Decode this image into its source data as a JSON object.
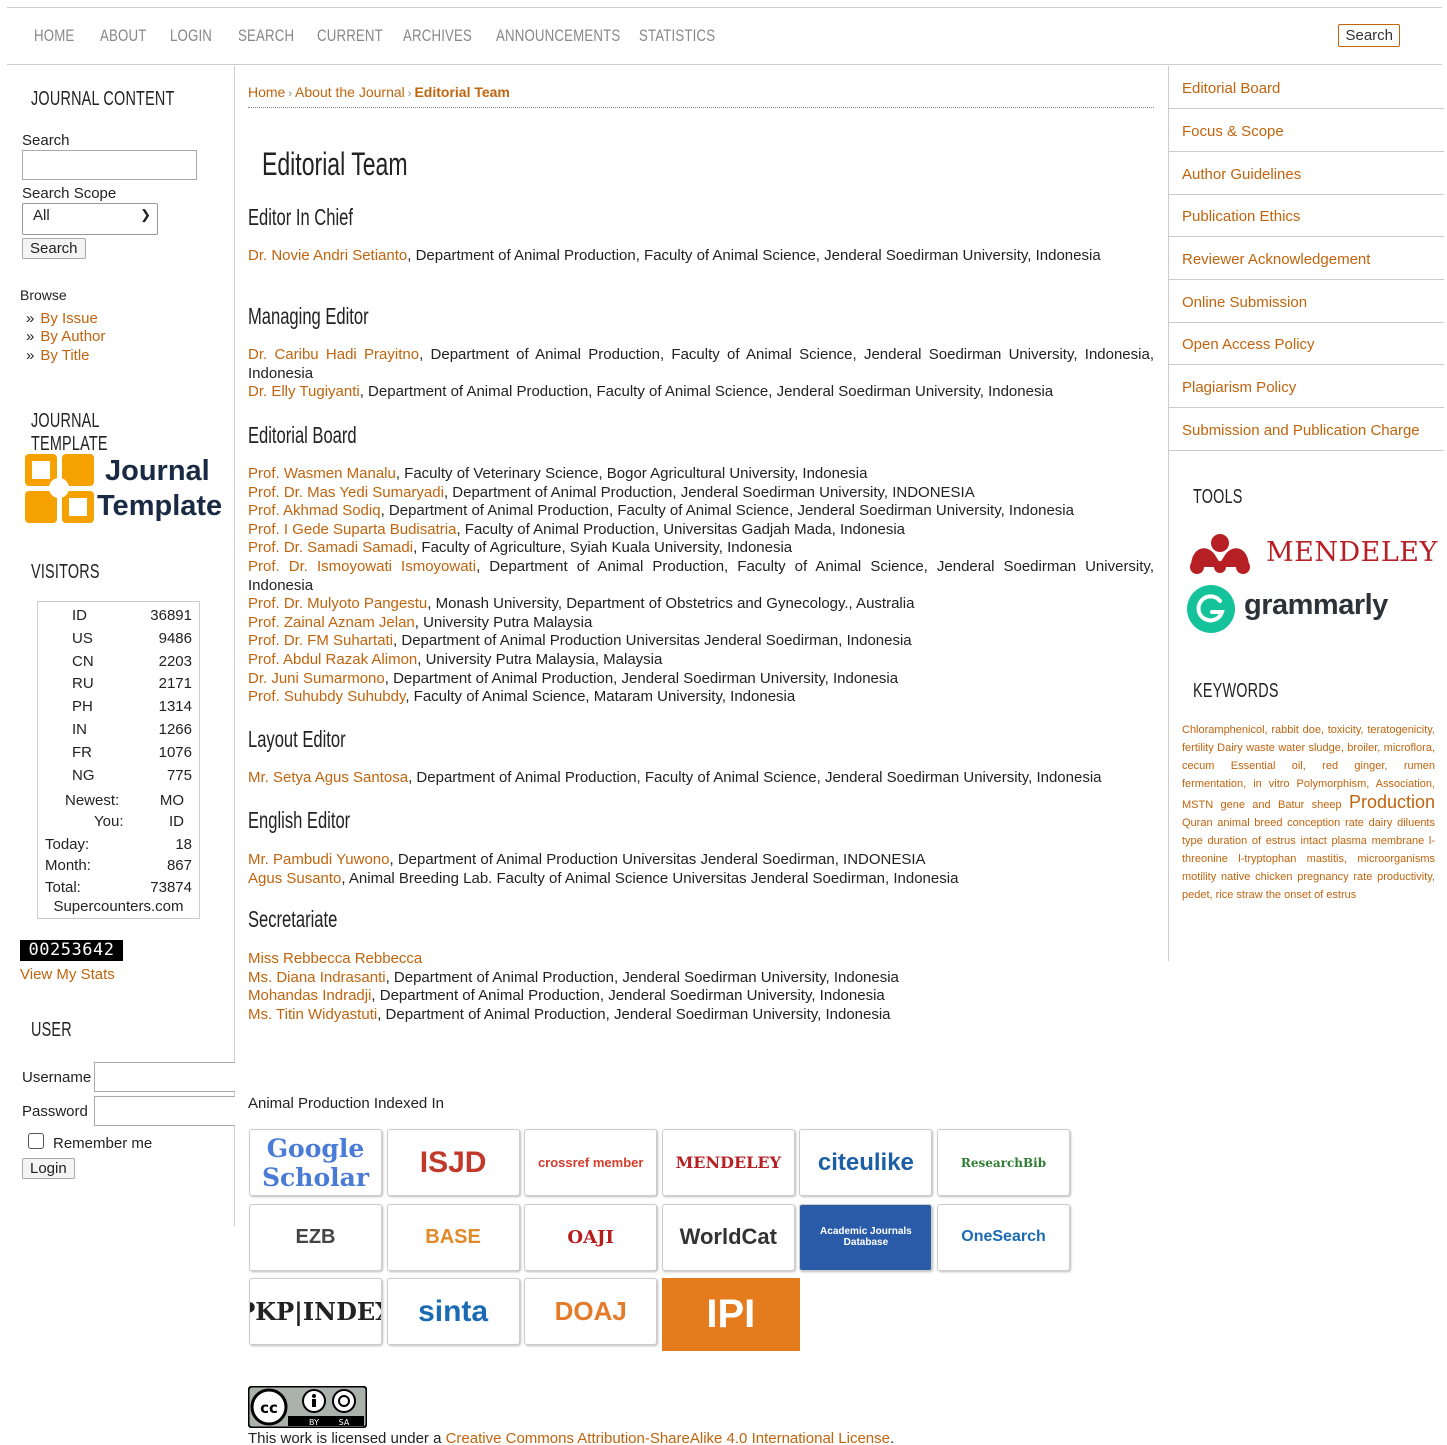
{
  "nav": {
    "items": [
      "Home",
      "About",
      "Login",
      "Search",
      "Current",
      "Archives",
      "Announcements",
      "Statistics"
    ],
    "search_button": "Search"
  },
  "left": {
    "journal_content_title": "Journal Content",
    "search_label": "Search",
    "scope_label": "Search Scope",
    "scope_value": "All",
    "search_button": "Search",
    "browse_label": "Browse",
    "browse_items": [
      "By Issue",
      "By Author",
      "By Title"
    ],
    "template_title": "Journal Template",
    "template_logo_line1": "Journal",
    "template_logo_line2": "Template",
    "visitors_title": "Visitors",
    "visitors": [
      {
        "code": "ID",
        "count": "36891"
      },
      {
        "code": "US",
        "count": "9486"
      },
      {
        "code": "CN",
        "count": "2203"
      },
      {
        "code": "RU",
        "count": "2171"
      },
      {
        "code": "PH",
        "count": "1314"
      },
      {
        "code": "IN",
        "count": "1266"
      },
      {
        "code": "FR",
        "count": "1076"
      },
      {
        "code": "NG",
        "count": "775"
      }
    ],
    "newest_label": "Newest:",
    "newest_value": "MO",
    "you_label": "You:",
    "you_value": "ID",
    "today_label": "Today:",
    "today_value": "18",
    "month_label": "Month:",
    "month_value": "867",
    "total_label": "Total:",
    "total_value": "73874",
    "counter_site": "Supercounters.com",
    "hit_counter": "00253642",
    "view_stats": "View My Stats",
    "user_title": "User",
    "username_label": "Username",
    "password_label": "Password",
    "remember_label": "Remember me",
    "login_button": "Login"
  },
  "breadcrumb": {
    "home": "Home",
    "about": "About the Journal",
    "current": "Editorial Team"
  },
  "page_title": "Editorial Team",
  "sections": {
    "chief_title": "Editor In Chief",
    "chief": [
      {
        "name": "Dr. Novie Andri Setianto",
        "affil": ", Department of Animal Production, Faculty of Animal Science, Jenderal Soedirman University, Indonesia"
      }
    ],
    "managing_title": "Managing Editor",
    "managing": [
      {
        "name": "Dr. Caribu Hadi Prayitno",
        "affil": ", Department of Animal Production, Faculty of Animal Science, Jenderal Soedirman University, Indonesia, Indonesia"
      },
      {
        "name": "Dr. Elly Tugiyanti",
        "affil": ", Department of Animal Production, Faculty of Animal Science, Jenderal Soedirman University, Indonesia"
      }
    ],
    "board_title": "Editorial Board",
    "board": [
      {
        "name": "Prof. Wasmen Manalu",
        "affil": ", Faculty of Veterinary Science, Bogor Agricultural University, Indonesia"
      },
      {
        "name": "Prof. Dr. Mas Yedi Sumaryadi",
        "affil": ", Department of Animal Production, Jenderal Soedirman University, INDONESIA"
      },
      {
        "name": "Prof. Akhmad Sodiq",
        "affil": ", Department of Animal Production, Faculty of Animal Science, Jenderal Soedirman University, Indonesia"
      },
      {
        "name": "Prof. I Gede Suparta Budisatria",
        "affil": ", Faculty of Animal Production, Universitas Gadjah Mada, Indonesia"
      },
      {
        "name": "Prof. Dr. Samadi Samadi",
        "affil": ", Faculty of Agriculture, Syiah Kuala University, Indonesia"
      },
      {
        "name": "Prof. Dr. Ismoyowati Ismoyowati",
        "affil": ", Department of Animal Production, Faculty of Animal Science, Jenderal Soedirman University, Indonesia"
      },
      {
        "name": "Prof. Dr. Mulyoto Pangestu",
        "affil": ", Monash University, Department of Obstetrics and Gynecology., Australia"
      },
      {
        "name": "Prof. Zainal Aznam Jelan",
        "affil": ", University Putra Malaysia"
      },
      {
        "name": "Prof. Dr. FM Suhartati",
        "affil": ", Department of Animal Production Universitas Jenderal Soedirman, Indonesia"
      },
      {
        "name": "Prof. Abdul Razak Alimon",
        "affil": ", University Putra Malaysia, Malaysia"
      },
      {
        "name": "Dr. Juni Sumarmono",
        "affil": ", Department of Animal Production, Jenderal Soedirman University, Indonesia"
      },
      {
        "name": "Prof. Suhubdy Suhubdy",
        "affil": ", Faculty of Animal Science, Mataram University, Indonesia"
      }
    ],
    "layout_title": "Layout Editor",
    "layout": [
      {
        "name": "Mr. Setya Agus Santosa",
        "affil": ", Department of Animal Production, Faculty of Animal Science, Jenderal Soedirman University, Indonesia"
      }
    ],
    "english_title": "English Editor",
    "english": [
      {
        "name": "Mr. Pambudi Yuwono",
        "affil": ", Department of Animal Production Universitas Jenderal Soedirman, INDONESIA"
      },
      {
        "name": "Agus Susanto",
        "affil": ", Animal Breeding Lab. Faculty of Animal Science Universitas Jenderal Soedirman, Indonesia"
      }
    ],
    "secretariate_title": "Secretariate",
    "secretariate": [
      {
        "name": "Miss Rebbecca Rebbecca",
        "affil": ""
      },
      {
        "name": "Ms. Diana Indrasanti",
        "affil": ", Department of Animal Production, Jenderal Soedirman University, Indonesia"
      },
      {
        "name": "Mohandas Indradji",
        "affil": ", Department of Animal Production, Jenderal Soedirman University, Indonesia"
      },
      {
        "name": "Ms. Titin Widyastuti",
        "affil": ", Department of Animal Production, Jenderal Soedirman University, Indonesia"
      }
    ]
  },
  "indexed": {
    "title": "Animal Production Indexed In",
    "logos": [
      "Google Scholar",
      "ISJD",
      "crossref member",
      "MENDELEY",
      "citeulike",
      "ResearchBib",
      "EZB",
      "BASE",
      "OAJI",
      "WorldCat",
      "Academic Journals Database",
      "OneSearch",
      "PKP|INDEX",
      "sinta",
      "DOAJ",
      "IPI"
    ]
  },
  "license": {
    "prefix": "This work is licensed under a ",
    "link": "Creative Commons Attribution-ShareAlike 4.0 International License",
    "suffix": "."
  },
  "right": {
    "nav": [
      "Editorial Board",
      "Focus & Scope",
      "Author Guidelines",
      "Publication Ethics",
      "Reviewer Acknowledgement",
      "Online Submission",
      "Open Access Policy",
      "Plagiarism Policy",
      "Submission and Publication Charge"
    ],
    "tools_title": "Tools",
    "mendeley": "MENDELEY",
    "grammarly": "grammarly",
    "keywords_title": "Keywords",
    "keywords_big": "Production",
    "keywords_before": "Chloramphenicol, rabbit doe, toxicity, teratogenicity, fertility Dairy waste water sludge, broiler, microflora, cecum Essential oil, red ginger, rumen fermentation, in vitro Polymorphism, Association, MSTN gene and Batur sheep",
    "keywords_after": "Quran animal breed conception rate dairy diluents type duration of estrus intact plasma membrane l-threonine l-tryptophan mastitis, microorganisms motility native chicken pregnancy rate productivity, pedet, rice straw the onset of estrus"
  },
  "colors": {
    "link": "#c0640e",
    "text": "#222222",
    "border": "#cccccc"
  }
}
